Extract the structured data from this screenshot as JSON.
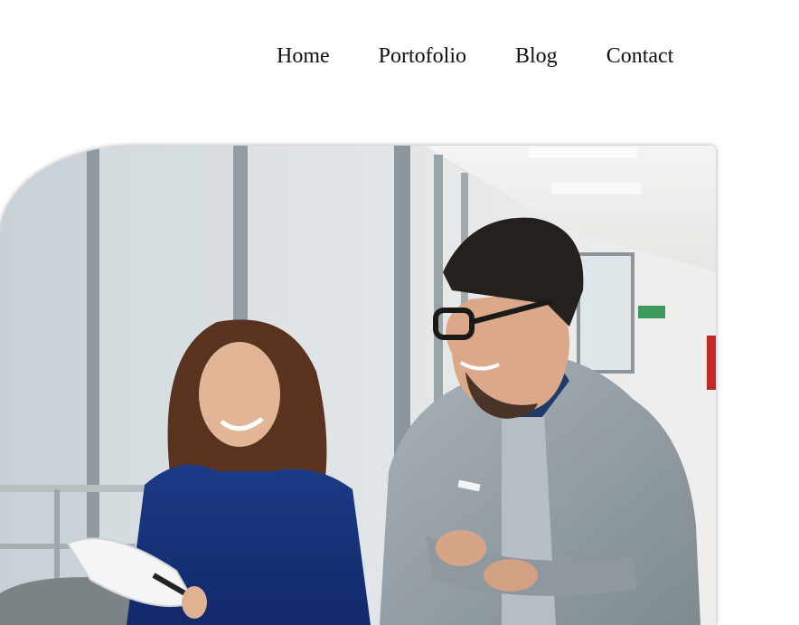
{
  "nav": {
    "items": [
      {
        "label": "Home"
      },
      {
        "label": "Portofolio"
      },
      {
        "label": "Blog"
      },
      {
        "label": "Contact"
      }
    ]
  },
  "hero": {
    "image": "office-photo: woman in navy dress holding papers, smiling man in glasses and grey blazer"
  },
  "colors": {
    "nav_text": "#111111",
    "background": "#ffffff"
  }
}
